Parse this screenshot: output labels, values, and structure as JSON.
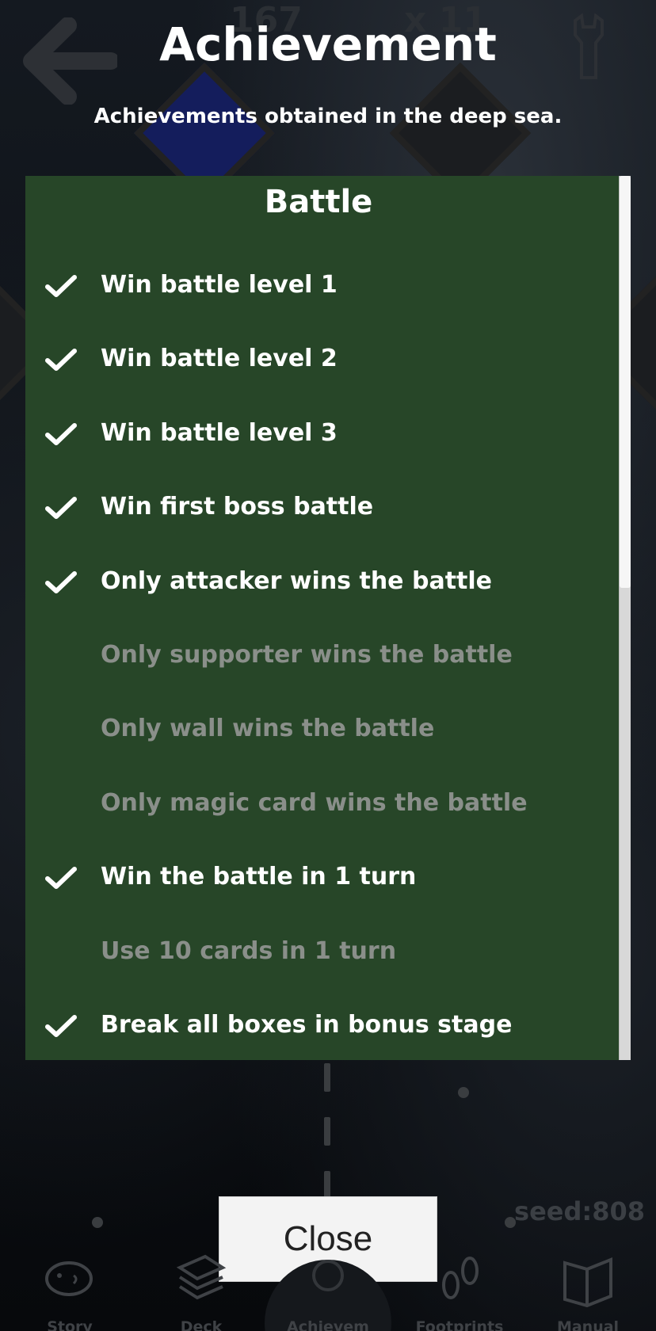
{
  "header": {
    "title": "Achievement",
    "subtitle": "Achievements obtained in the deep sea."
  },
  "panel": {
    "title": "Battle",
    "items": [
      {
        "label": "Win battle level 1",
        "done": true
      },
      {
        "label": "Win battle level 2",
        "done": true
      },
      {
        "label": "Win battle level 3",
        "done": true
      },
      {
        "label": "Win first boss battle",
        "done": true
      },
      {
        "label": "Only attacker wins the battle",
        "done": true
      },
      {
        "label": "Only supporter wins the battle",
        "done": false
      },
      {
        "label": "Only wall wins the battle",
        "done": false
      },
      {
        "label": "Only magic card wins the battle",
        "done": false
      },
      {
        "label": "Win the battle in 1 turn",
        "done": true
      },
      {
        "label": "Use 10 cards in 1 turn",
        "done": false
      },
      {
        "label": "Break all boxes in bonus stage",
        "done": true
      }
    ]
  },
  "close_label": "Close",
  "background": {
    "counter_left": "167",
    "counter_right": "x 11",
    "seed": "seed:808"
  },
  "nav": {
    "items": [
      {
        "label": "Story",
        "icon": "fish-icon"
      },
      {
        "label": "Deck",
        "icon": "cards-icon"
      },
      {
        "label": "Achievem",
        "icon": "medal-icon"
      },
      {
        "label": "Footprints",
        "icon": "footprints-icon"
      },
      {
        "label": "Manual",
        "icon": "book-icon"
      }
    ]
  },
  "colors": {
    "panel": "#274628",
    "done_text": "#ffffff",
    "locked_text": "#8a8f8a"
  }
}
